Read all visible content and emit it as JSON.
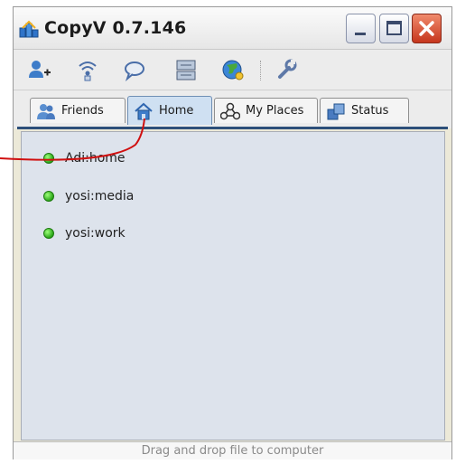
{
  "window": {
    "title": "CopyV 0.7.146",
    "buttons": {
      "minimize_icon": "minimize-icon",
      "maximize_icon": "maximize-icon",
      "close_icon": "close-icon"
    }
  },
  "toolbar": {
    "buttons": [
      {
        "icon": "add-user-icon"
      },
      {
        "icon": "wireless-icon"
      },
      {
        "icon": "chat-icon"
      },
      {
        "icon": "network-icon"
      },
      {
        "icon": "globe-icon"
      },
      {
        "icon": "wrench-icon"
      }
    ]
  },
  "tabs": [
    {
      "label": "Friends",
      "icon": "friends-icon",
      "active": false
    },
    {
      "label": "Home",
      "icon": "home-icon",
      "active": true
    },
    {
      "label": "My Places",
      "icon": "places-icon",
      "active": false
    },
    {
      "label": "Status",
      "icon": "status-icon",
      "active": false
    }
  ],
  "places": [
    {
      "label": "Adi:home",
      "status": "online"
    },
    {
      "label": "yosi:media",
      "status": "online"
    },
    {
      "label": "yosi:work",
      "status": "online"
    }
  ],
  "statusbar": {
    "text": "Drag and drop file to computer"
  },
  "colors": {
    "online": "#2aa618",
    "annotation": "#d01010",
    "tab_active": "#cfe0f2",
    "list_bg": "#dde3ec"
  }
}
